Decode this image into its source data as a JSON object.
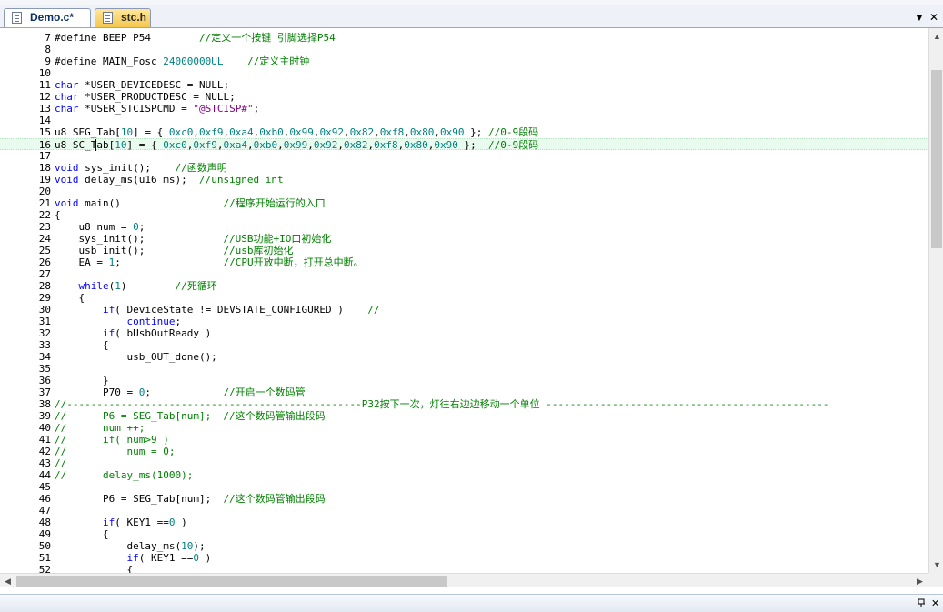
{
  "tabs": [
    {
      "label": "Demo.c*",
      "active": true
    },
    {
      "label": "stc.h",
      "active": false
    }
  ],
  "tabbar_controls": {
    "dropdown_icon": "▼",
    "close_icon": "✕"
  },
  "editor": {
    "current_line": 16,
    "lines": [
      {
        "n": 7,
        "tokens": [
          [
            "#define BEEP P54        ",
            "p"
          ],
          [
            "//定义一个按键 引脚选择P54",
            "c"
          ]
        ]
      },
      {
        "n": 8,
        "tokens": []
      },
      {
        "n": 9,
        "tokens": [
          [
            "#define MAIN_Fosc ",
            "p"
          ],
          [
            "24000000UL",
            "n"
          ],
          [
            "    ",
            "p"
          ],
          [
            "//定义主时钟",
            "c"
          ]
        ]
      },
      {
        "n": 10,
        "tokens": []
      },
      {
        "n": 11,
        "tokens": [
          [
            "char",
            "k"
          ],
          [
            " *USER_DEVICEDESC = NULL;",
            "p"
          ]
        ]
      },
      {
        "n": 12,
        "tokens": [
          [
            "char",
            "k"
          ],
          [
            " *USER_PRODUCTDESC = NULL;",
            "p"
          ]
        ]
      },
      {
        "n": 13,
        "tokens": [
          [
            "char",
            "k"
          ],
          [
            " *USER_STCISPCMD = ",
            "p"
          ],
          [
            "\"@STCISP#\"",
            "s"
          ],
          [
            ";",
            "p"
          ]
        ]
      },
      {
        "n": 14,
        "tokens": []
      },
      {
        "n": 15,
        "tokens": [
          [
            "u8 SEG_Tab[",
            "p"
          ],
          [
            "10",
            "n"
          ],
          [
            "] = { ",
            "p"
          ],
          [
            "0xc0",
            "n"
          ],
          [
            ",",
            "p"
          ],
          [
            "0xf9",
            "n"
          ],
          [
            ",",
            "p"
          ],
          [
            "0xa4",
            "n"
          ],
          [
            ",",
            "p"
          ],
          [
            "0xb0",
            "n"
          ],
          [
            ",",
            "p"
          ],
          [
            "0x99",
            "n"
          ],
          [
            ",",
            "p"
          ],
          [
            "0x92",
            "n"
          ],
          [
            ",",
            "p"
          ],
          [
            "0x82",
            "n"
          ],
          [
            ",",
            "p"
          ],
          [
            "0xf8",
            "n"
          ],
          [
            ",",
            "p"
          ],
          [
            "0x80",
            "n"
          ],
          [
            ",",
            "p"
          ],
          [
            "0x90",
            "n"
          ],
          [
            " }; ",
            "p"
          ],
          [
            "//0-9段码",
            "c"
          ]
        ]
      },
      {
        "n": 16,
        "tokens": [
          [
            "u8 SC_Tab[",
            "p"
          ],
          [
            "10",
            "n"
          ],
          [
            "] = { ",
            "p"
          ],
          [
            "0xc0",
            "n"
          ],
          [
            ",",
            "p"
          ],
          [
            "0xf9",
            "n"
          ],
          [
            ",",
            "p"
          ],
          [
            "0xa4",
            "n"
          ],
          [
            ",",
            "p"
          ],
          [
            "0xb0",
            "n"
          ],
          [
            ",",
            "p"
          ],
          [
            "0x99",
            "n"
          ],
          [
            ",",
            "p"
          ],
          [
            "0x92",
            "n"
          ],
          [
            ",",
            "p"
          ],
          [
            "0x82",
            "n"
          ],
          [
            ",",
            "p"
          ],
          [
            "0xf8",
            "n"
          ],
          [
            ",",
            "p"
          ],
          [
            "0x80",
            "n"
          ],
          [
            ",",
            "p"
          ],
          [
            "0x90",
            "n"
          ],
          [
            " };  ",
            "p"
          ],
          [
            "//0-9段码",
            "c"
          ]
        ]
      },
      {
        "n": 17,
        "tokens": []
      },
      {
        "n": 18,
        "tokens": [
          [
            "void",
            "k"
          ],
          [
            " sys_init();    ",
            "p"
          ],
          [
            "//函数声明",
            "c"
          ]
        ]
      },
      {
        "n": 19,
        "tokens": [
          [
            "void",
            "k"
          ],
          [
            " delay_ms(u16 ms);  ",
            "p"
          ],
          [
            "//unsigned int",
            "c"
          ]
        ]
      },
      {
        "n": 20,
        "tokens": []
      },
      {
        "n": 21,
        "tokens": [
          [
            "void",
            "k"
          ],
          [
            " main()                 ",
            "p"
          ],
          [
            "//程序开始运行的入口",
            "c"
          ]
        ]
      },
      {
        "n": 22,
        "tokens": [
          [
            "{",
            "p"
          ]
        ]
      },
      {
        "n": 23,
        "tokens": [
          [
            "    u8 num = ",
            "p"
          ],
          [
            "0",
            "n"
          ],
          [
            ";",
            "p"
          ]
        ]
      },
      {
        "n": 24,
        "tokens": [
          [
            "    sys_init();             ",
            "p"
          ],
          [
            "//USB功能+IO口初始化",
            "c"
          ]
        ]
      },
      {
        "n": 25,
        "tokens": [
          [
            "    usb_init();             ",
            "p"
          ],
          [
            "//usb库初始化",
            "c"
          ]
        ]
      },
      {
        "n": 26,
        "tokens": [
          [
            "    EA = ",
            "p"
          ],
          [
            "1",
            "n"
          ],
          [
            ";                 ",
            "p"
          ],
          [
            "//CPU开放中断，打开总中断。",
            "c"
          ]
        ]
      },
      {
        "n": 27,
        "tokens": []
      },
      {
        "n": 28,
        "tokens": [
          [
            "    ",
            "p"
          ],
          [
            "while",
            "k"
          ],
          [
            "(",
            "p"
          ],
          [
            "1",
            "n"
          ],
          [
            ")        ",
            "p"
          ],
          [
            "//死循环",
            "c"
          ]
        ]
      },
      {
        "n": 29,
        "tokens": [
          [
            "    {",
            "p"
          ]
        ]
      },
      {
        "n": 30,
        "tokens": [
          [
            "        ",
            "p"
          ],
          [
            "if",
            "k"
          ],
          [
            "( DeviceState != DEVSTATE_CONFIGURED )    ",
            "p"
          ],
          [
            "//",
            "c"
          ]
        ]
      },
      {
        "n": 31,
        "tokens": [
          [
            "            ",
            "p"
          ],
          [
            "continue",
            "k"
          ],
          [
            ";",
            "p"
          ]
        ]
      },
      {
        "n": 32,
        "tokens": [
          [
            "        ",
            "p"
          ],
          [
            "if",
            "k"
          ],
          [
            "( bUsbOutReady )",
            "p"
          ]
        ]
      },
      {
        "n": 33,
        "tokens": [
          [
            "        {",
            "p"
          ]
        ]
      },
      {
        "n": 34,
        "tokens": [
          [
            "            usb_OUT_done();",
            "p"
          ]
        ]
      },
      {
        "n": 35,
        "tokens": []
      },
      {
        "n": 36,
        "tokens": [
          [
            "        }",
            "p"
          ]
        ]
      },
      {
        "n": 37,
        "tokens": [
          [
            "        P70 = ",
            "p"
          ],
          [
            "0",
            "n"
          ],
          [
            ";            ",
            "p"
          ],
          [
            "//开启一个数码管",
            "c"
          ]
        ]
      },
      {
        "n": 38,
        "tokens": [
          [
            "//-------------------------------------------------P32按下一次，灯往右边边移动一个单位 -----------------------------------------------",
            "c"
          ]
        ]
      },
      {
        "n": 39,
        "tokens": [
          [
            "//      P6 = SEG_Tab[num];  //这个数码管输出段码",
            "c"
          ]
        ]
      },
      {
        "n": 40,
        "tokens": [
          [
            "//      num ++;",
            "c"
          ]
        ]
      },
      {
        "n": 41,
        "tokens": [
          [
            "//      if( num>9 )",
            "c"
          ]
        ]
      },
      {
        "n": 42,
        "tokens": [
          [
            "//          num = 0;",
            "c"
          ]
        ]
      },
      {
        "n": 43,
        "tokens": [
          [
            "//",
            "c"
          ]
        ]
      },
      {
        "n": 44,
        "tokens": [
          [
            "//      delay_ms(1000);",
            "c"
          ]
        ]
      },
      {
        "n": 45,
        "tokens": []
      },
      {
        "n": 46,
        "tokens": [
          [
            "        P6 = SEG_Tab[num];  ",
            "p"
          ],
          [
            "//这个数码管输出段码",
            "c"
          ]
        ]
      },
      {
        "n": 47,
        "tokens": []
      },
      {
        "n": 48,
        "tokens": [
          [
            "        ",
            "p"
          ],
          [
            "if",
            "k"
          ],
          [
            "( KEY1 ==",
            "p"
          ],
          [
            "0",
            "n"
          ],
          [
            " )",
            "p"
          ]
        ]
      },
      {
        "n": 49,
        "tokens": [
          [
            "        {",
            "p"
          ]
        ]
      },
      {
        "n": 50,
        "tokens": [
          [
            "            delay_ms(",
            "p"
          ],
          [
            "10",
            "n"
          ],
          [
            ");",
            "p"
          ]
        ]
      },
      {
        "n": 51,
        "tokens": [
          [
            "            ",
            "p"
          ],
          [
            "if",
            "k"
          ],
          [
            "( KEY1 ==",
            "p"
          ],
          [
            "0",
            "n"
          ],
          [
            " )",
            "p"
          ]
        ]
      },
      {
        "n": 52,
        "tokens": [
          [
            "            {",
            "p"
          ]
        ]
      }
    ]
  },
  "scrollbars": {
    "vertical_position": 0.04,
    "horizontal_position": 0.0
  },
  "bottom_pane": {
    "pin_icon": "pin-icon",
    "close_icon": "✕"
  },
  "colors": {
    "keyword": "#0000ff",
    "comment": "#008000",
    "number": "#008080",
    "string": "#800080",
    "current_line_bg": "#e9fbef"
  }
}
